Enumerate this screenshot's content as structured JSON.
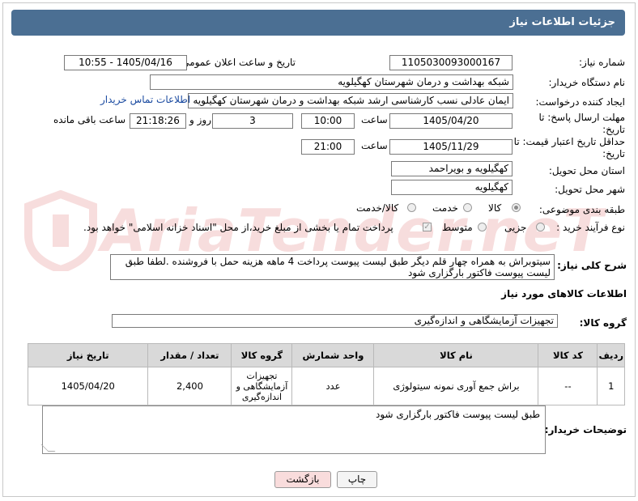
{
  "header": {
    "title": "جزئیات اطلاعات نیاز"
  },
  "fields": {
    "need_number_label": "شماره نیاز:",
    "need_number": "1105030093000167",
    "announce_label": "تاریخ و ساعت اعلان عمومی:",
    "announce_value": "1405/04/16 - 10:55",
    "buyer_org_label": "نام دستگاه خریدار:",
    "buyer_org": "شبکه بهداشت و درمان شهرستان کهگیلویه",
    "creator_label": "ایجاد کننده درخواست:",
    "creator": "ایمان عادلی نسب کارشناسی ارشد شبکه بهداشت و درمان شهرستان کهگیلویه",
    "contact_link": "اطلاعات تماس خریدار",
    "deadline_label": "مهلت ارسال پاسخ: تا تاریخ:",
    "deadline_date": "1405/04/20",
    "hour_label": "ساعت",
    "deadline_time": "10:00",
    "days": "3",
    "days_label": "روز و",
    "remaining_time": "21:18:26",
    "remaining_label": "ساعت باقی مانده",
    "validity_label": "حداقل تاریخ اعتبار قیمت: تا تاریخ:",
    "validity_date": "1405/11/29",
    "validity_time": "21:00",
    "province_label": "استان محل تحویل:",
    "province": "کهگیلویه و بویراحمد",
    "city_label": "شهر محل تحویل:",
    "city": "کهگیلویه",
    "category_label": "طبقه بندی موضوعی:",
    "category_options": [
      "کالا",
      "خدمت",
      "کالا/خدمت"
    ],
    "process_label": "نوع فرآیند خرید :",
    "process_options": [
      "جزیی",
      "متوسط"
    ],
    "process_note": "پرداخت تمام یا بخشی از مبلغ خرید،از محل \"اسناد خزانه اسلامی\" خواهد بود."
  },
  "summary": {
    "label": "شرح کلی نیاز:",
    "text_line1": "سیتوبراش  به همراه چهار قلم دیگر طبق لیست  پیوست پرداخت 4 ماهه هزینه حمل با فروشنده .لطفا طبق",
    "text_line2": "لیست پیوست فاکتور بارگزاری شود"
  },
  "goods_info_title": "اطلاعات کالاهای مورد نیاز",
  "goods_group": {
    "label": "گروه کالا:",
    "value": "تجهیزات آزمایشگاهی و اندازه‌گیری"
  },
  "table": {
    "headers": [
      "ردیف",
      "کد کالا",
      "نام کالا",
      "واحد شمارش",
      "گروه کالا",
      "تعداد / مقدار",
      "تاریخ نیاز"
    ],
    "rows": [
      {
        "row": "1",
        "code": "--",
        "name": "براش جمع آوری نمونه سیتولوژی",
        "unit": "عدد",
        "group_l1": "تجهیزات",
        "group_l2": "آزمایشگاهی و",
        "group_l3": "اندازه‌گیری",
        "qty": "2,400",
        "date": "1405/04/20"
      }
    ]
  },
  "buyer_notes": {
    "label": "توضیحات خریدار:",
    "text": "طبق لیست پیوست فاکتور بارگزاری شود"
  },
  "buttons": {
    "print": "چاپ",
    "back": "بازگشت"
  },
  "watermark": {
    "text": "AriaTender.neT"
  },
  "colors": {
    "header": "#4b6f93",
    "back_button": "#f9dcdc",
    "link": "#1a4aa0"
  }
}
